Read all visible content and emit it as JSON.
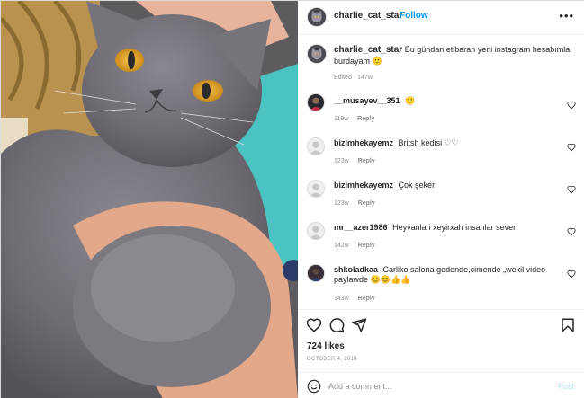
{
  "post": {
    "author": "charlie_cat_star",
    "separator": "•",
    "follow_label": "Follow",
    "more_label": "•••",
    "caption": "Bu gündan etibaran yeni instagram hesabımla burdayam 🙂",
    "edited": "Edited · 147w"
  },
  "comments": [
    {
      "username": "__musayev__351",
      "text": "🙂",
      "time": "119w",
      "reply": "Reply",
      "avatar": "dark-avatar"
    },
    {
      "username": "bizimhekayemz",
      "text": "Britsh kedisi ♡♡",
      "time": "123w",
      "reply": "Reply",
      "avatar": "default-avatar"
    },
    {
      "username": "bizimhekayemz",
      "text": "Çok şeker",
      "time": "123w",
      "reply": "Reply",
      "avatar": "default-avatar"
    },
    {
      "username": "mr__azer1986",
      "text": "Heyvanlari xeyirxah insanlar sever",
      "time": "142w",
      "reply": "Reply",
      "avatar": "default-avatar"
    },
    {
      "username": "shkoladkaa",
      "text": "Carliko salona gedende,cimende „wekil video paylawde 😊😊👍👍",
      "time": "143w",
      "reply": "Reply",
      "avatar": "photo-avatar"
    }
  ],
  "stats": {
    "likes": "724 likes",
    "date": "OCTOBER 4, 2019"
  },
  "composer": {
    "placeholder": "Add a comment...",
    "post_label": "Post"
  },
  "icons": {
    "like": "heart-icon",
    "comment": "comment-icon",
    "share": "share-icon",
    "save": "bookmark-icon",
    "emoji": "emoji-icon",
    "more": "more-icon"
  },
  "colors": {
    "accent": "#0095f6",
    "post_disabled": "#b2dffc",
    "muted": "#8e8e8e",
    "text": "#262626",
    "border": "#dbdbdb"
  }
}
